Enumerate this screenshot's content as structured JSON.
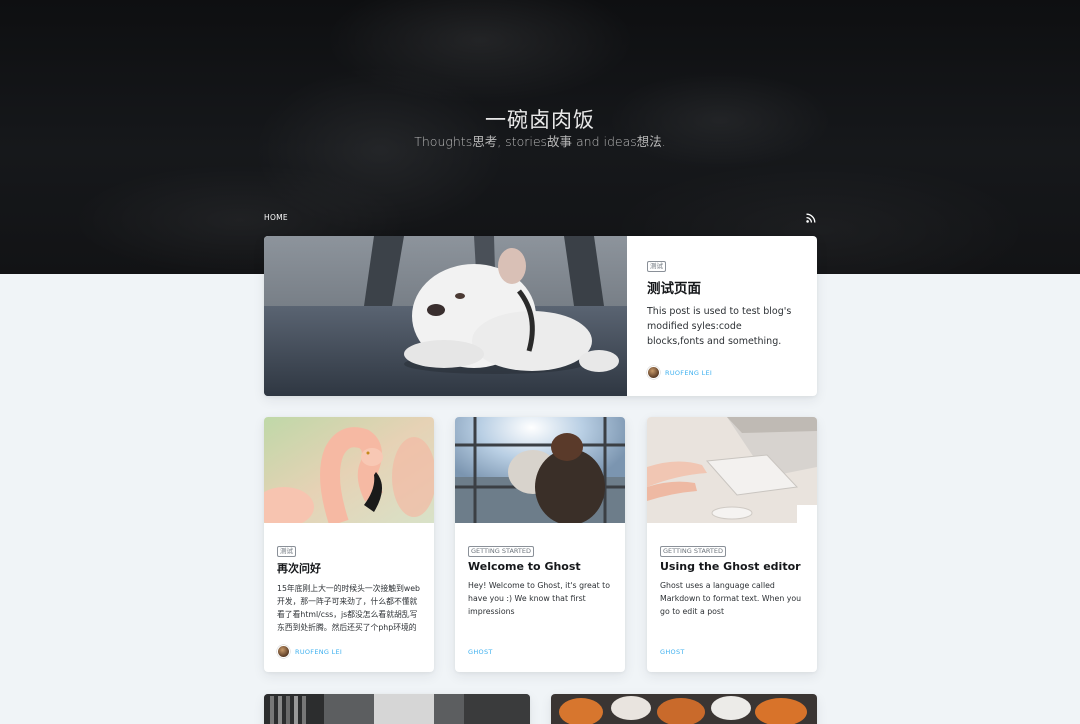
{
  "site": {
    "title": "一碗卤肉饭",
    "description": "Thoughts思考, stories故事 and ideas想法."
  },
  "nav": {
    "home_label": "HOME",
    "rss_icon": "rss-icon"
  },
  "featured_post": {
    "tag": "测试",
    "title": "测试页面",
    "excerpt": "This post is used to test blog's modified syles:code blocks,fonts and something.",
    "author": "RUOFENG LEI"
  },
  "posts": [
    {
      "tag": "测试",
      "title": "再次问好",
      "excerpt": "15年底刚上大一的时候头一次接触到web开发，那一阵子可来劲了，什么都不懂就看了看html/css，js都没怎么看就胡乱写东西到处折腾。然后还买了个php环境的",
      "author": "RUOFENG LEI"
    },
    {
      "tag": "GETTING STARTED",
      "title": "Welcome to Ghost",
      "excerpt": "Hey! Welcome to Ghost, it's great to have you :) We know that first impressions",
      "author": "GHOST"
    },
    {
      "tag": "GETTING STARTED",
      "title": "Using the Ghost editor",
      "excerpt": "Ghost uses a language called Markdown to format text. When you go to edit a post",
      "author": "GHOST"
    }
  ],
  "colors": {
    "accent": "#3eb0ef",
    "hero_bg": "#121315",
    "page_bg": "#f0f4f7"
  }
}
